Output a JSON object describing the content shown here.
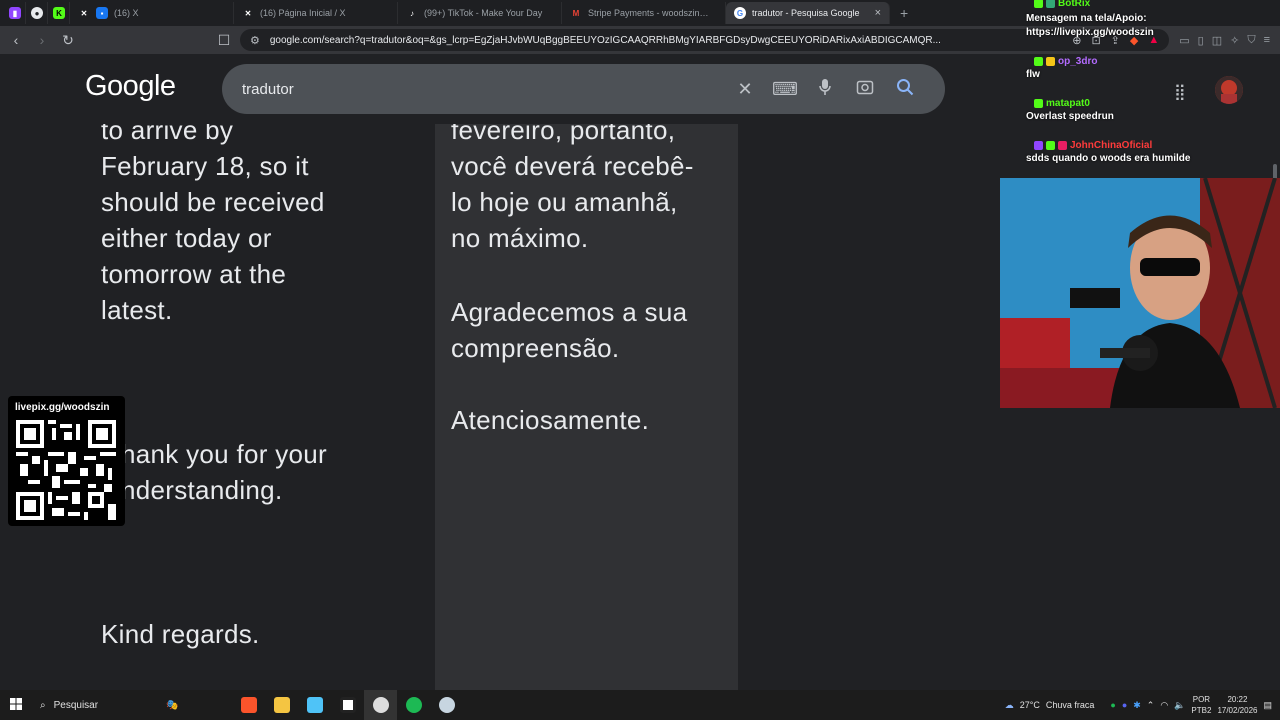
{
  "browser": {
    "tabs": [
      {
        "title": "",
        "icon": "twitch-icon",
        "color": "#9146ff"
      },
      {
        "title": "",
        "icon": "chrome-icon",
        "color": "#e8eaed"
      },
      {
        "title": "",
        "icon": "kick-icon",
        "color": "#53fc18"
      },
      {
        "title": "(16) X",
        "icon": "x-icon",
        "color": "#ffffff"
      },
      {
        "title": "(16) Página Inicial / X",
        "icon": "x-icon",
        "color": "#ffffff"
      },
      {
        "title": "(99+) TikTok - Make Your Day",
        "icon": "tiktok-icon",
        "color": "#ffffff"
      },
      {
        "title": "Stripe Payments - woodszin@gmail.c",
        "icon": "gmail-icon",
        "color": "#ea4335"
      },
      {
        "title": "tradutor - Pesquisa Google",
        "icon": "google-icon",
        "color": "#ffffff"
      }
    ],
    "url": "google.com/search?q=tradutor&oq=&gs_lcrp=EgZjaHJvbWUqBggBEEUYOzIGCAAQRRhBMgYIARBFGDsyDwgCEEUYORiDARixAxiABDIGCAMQR..."
  },
  "google": {
    "logo": "Google",
    "query": "tradutor"
  },
  "translation": {
    "source_lines_top": [
      "to arrive by",
      "February 18, so it",
      "should be received",
      "either today or",
      "tomorrow at the",
      "latest."
    ],
    "source_lines_thanks": [
      "hank you for your",
      "nderstanding."
    ],
    "source_regards": "Kind regards.",
    "target_lines_top": [
      "fevereiro, portanto,",
      "você deverá recebê-",
      "lo hoje ou amanhã,",
      "no máximo."
    ],
    "target_lines_thanks": [
      "Agradecemos a sua",
      "compreensão."
    ],
    "target_regards": "Atenciosamente."
  },
  "overlay": {
    "qr_label": "livepix.gg/woodszin",
    "chat": [
      {
        "user": "BotRix",
        "message": "Mensagem na tela/Apoio: https://livepix.gg/woodszin",
        "color": "#53fc18"
      },
      {
        "user": "op_3dro",
        "message": "flw",
        "color": "#b36bff"
      },
      {
        "user": "matapat0",
        "message": "Overlast speedrun",
        "color": "#53fc18"
      },
      {
        "user": "JohnChinaOficial",
        "message": "sdds quando o woods era humilde",
        "color": "#ff3b3b"
      }
    ]
  },
  "taskbar": {
    "search_label": "Pesquisar",
    "weather_temp": "27°C",
    "weather_desc": "Chuva fraca",
    "lang_top": "POR",
    "lang_bottom": "PTB2",
    "time": "20:22",
    "date": "17/02/2026"
  }
}
